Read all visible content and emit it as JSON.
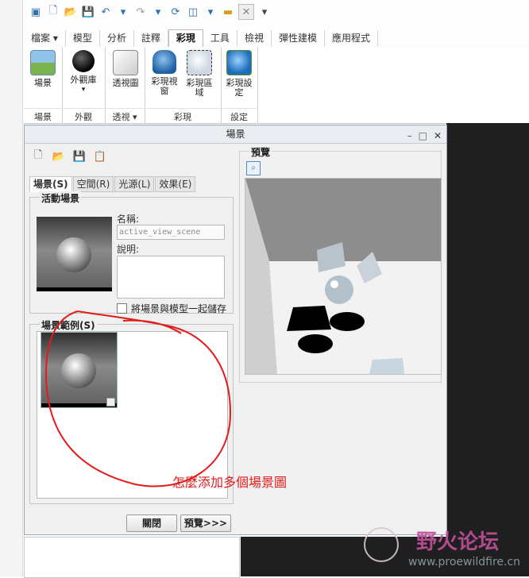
{
  "tabs": [
    "檔案",
    "模型",
    "分析",
    "註釋",
    "彩現",
    "工具",
    "檢視",
    "彈性建模",
    "應用程式"
  ],
  "active_tab": "彩現",
  "ribbon": {
    "scene_btn": "場景",
    "appearance_btn": "外觀庫",
    "perspective_btn": "透視圖",
    "render_window_btn": "彩現視窗",
    "render_region_btn": "彩現區域",
    "render_setup_btn": "彩現設定",
    "groups": {
      "scene": "場景",
      "appearance": "外觀",
      "perspective": "透視",
      "render": "彩現",
      "setup": "設定"
    }
  },
  "dialog": {
    "title": "場景",
    "tabs": [
      "場景(S)",
      "空間(R)",
      "光源(L)",
      "效果(E)"
    ],
    "active_scene_legend": "活動場景",
    "name_label": "名稱:",
    "name_value": "active_view_scene",
    "desc_label": "說明:",
    "save_checkbox_label": "將場景與模型一起儲存",
    "gallery_legend": "場景範例(S)",
    "preview_legend": "預覽",
    "close_btn": "關閉",
    "preview_btn": "預覽>>>"
  },
  "annotation": "怎麼添加多個場景圖",
  "watermark": {
    "title": "野火论坛",
    "url": "www.proewildfire.cn"
  },
  "colors": {
    "accent": "#2e6fb0",
    "annotation_red": "#e21b1b"
  }
}
